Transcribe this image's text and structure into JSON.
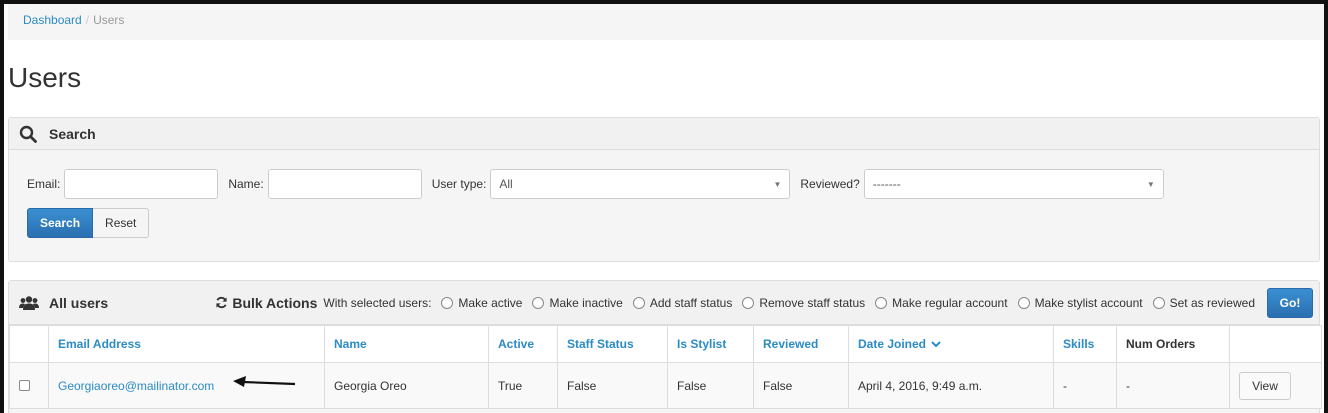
{
  "breadcrumb": {
    "home": "Dashboard",
    "separator": "/",
    "current": "Users"
  },
  "page": {
    "title": "Users"
  },
  "search_panel": {
    "title": "Search",
    "fields": {
      "email_label": "Email:",
      "email_value": "",
      "name_label": "Name:",
      "name_value": "",
      "user_type_label": "User type:",
      "user_type_value": "All",
      "reviewed_label": "Reviewed?",
      "reviewed_value": "-------"
    },
    "search_button": "Search",
    "reset_button": "Reset"
  },
  "users_panel": {
    "title": "All users",
    "bulk_title": "Bulk Actions",
    "with_selected": "With selected users:",
    "actions": [
      "Make active",
      "Make inactive",
      "Add staff status",
      "Remove staff status",
      "Make regular account",
      "Make stylist account",
      "Set as reviewed"
    ],
    "go_button": "Go!"
  },
  "table": {
    "columns": [
      "Email Address",
      "Name",
      "Active",
      "Staff Status",
      "Is Stylist",
      "Reviewed",
      "Date Joined",
      "Skills",
      "Num Orders"
    ],
    "rows": [
      {
        "email": "Georgiaoreo@mailinator.com",
        "name": "Georgia Oreo",
        "active": "True",
        "staff_status": "False",
        "is_stylist": "False",
        "reviewed": "False",
        "date_joined": "April 4, 2016, 9:49 a.m.",
        "skills": "-",
        "num_orders": "-",
        "view_button": "View"
      }
    ]
  },
  "colors": {
    "link": "#2b8bc6",
    "primary_button": "#2a6fb0",
    "panel_bg": "#f5f5f5"
  },
  "icons": {
    "search": "magnifier-icon",
    "users": "users-group-icon",
    "bulk": "refresh-icon",
    "sort": "chevron-down-icon",
    "annotation": "arrow-left-icon"
  }
}
